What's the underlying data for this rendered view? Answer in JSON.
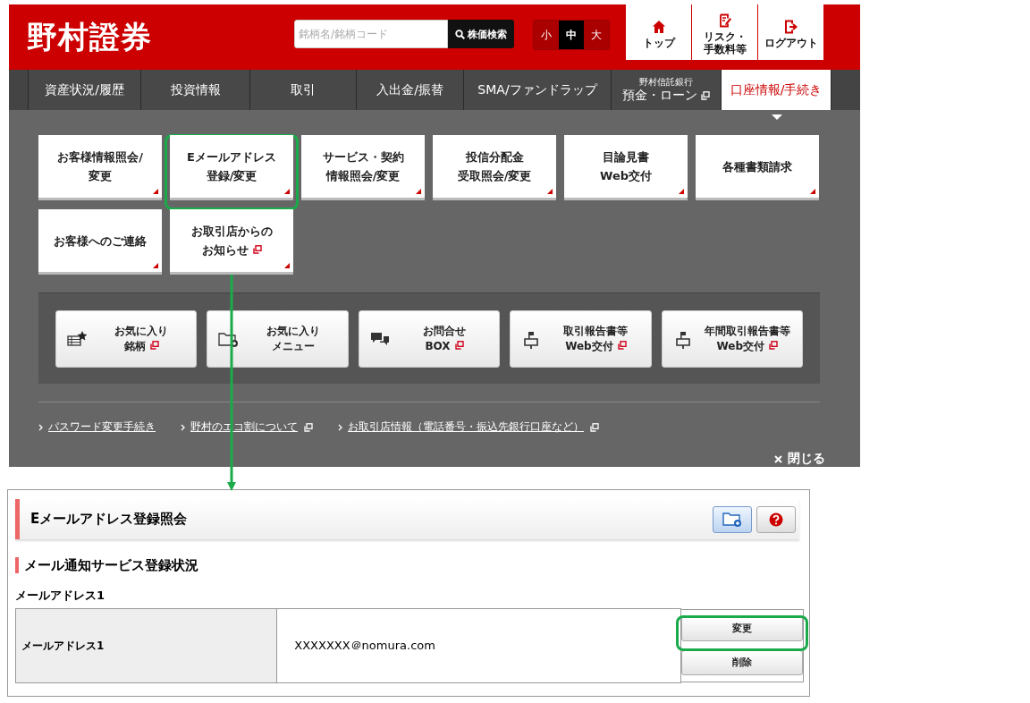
{
  "header": {
    "logo": "野村證券",
    "search": {
      "placeholder": "銘柄名/銘柄コード",
      "button": "株価検索"
    },
    "font_sizes": [
      {
        "label": "小",
        "selected": false
      },
      {
        "label": "中",
        "selected": true
      },
      {
        "label": "大",
        "selected": false
      }
    ],
    "top_links": [
      {
        "kind": "home",
        "label": "トップ"
      },
      {
        "kind": "risk",
        "label": [
          "リスク・",
          "手数料等"
        ]
      },
      {
        "kind": "logout",
        "label": "ログアウト"
      }
    ]
  },
  "nav": {
    "items": [
      {
        "label": "資産状況/履歴",
        "selected": false,
        "external": false
      },
      {
        "label": "投資情報",
        "selected": false,
        "external": false
      },
      {
        "label": "取引",
        "selected": false,
        "external": false
      },
      {
        "label": "入出金/振替",
        "selected": false,
        "external": false
      },
      {
        "label": "SMA/ファンドラップ",
        "selected": false,
        "external": false
      },
      {
        "sublabel": "野村信託銀行",
        "label": "預金・ローン",
        "selected": false,
        "external": true
      },
      {
        "label": "口座情報/手続き",
        "selected": true,
        "external": false
      }
    ]
  },
  "menu": {
    "tiles": [
      {
        "label": [
          "お客様情報照会/",
          "変更"
        ],
        "external": false,
        "highlighted": false
      },
      {
        "label": [
          "Eメールアドレス",
          "登録/変更"
        ],
        "external": false,
        "highlighted": true
      },
      {
        "label": [
          "サービス・契約",
          "情報照会/変更"
        ],
        "external": false,
        "highlighted": false
      },
      {
        "label": [
          "投信分配金",
          "受取照会/変更"
        ],
        "external": false,
        "highlighted": false
      },
      {
        "label": [
          "目論見書",
          "Web交付"
        ],
        "external": false,
        "highlighted": false
      },
      {
        "label": [
          "各種書類請求"
        ],
        "external": false,
        "highlighted": false
      },
      {
        "label": [
          "お客様へのご連絡"
        ],
        "external": false,
        "highlighted": false
      },
      {
        "label": [
          "お取引店からの",
          "お知らせ"
        ],
        "external": true,
        "highlighted": false
      }
    ],
    "shortcuts": [
      {
        "kind": "favorite-stocks",
        "label": [
          "お気に入り",
          "銘柄"
        ],
        "external": true
      },
      {
        "kind": "favorite-menu",
        "label": [
          "お気に入り",
          "メニュー"
        ],
        "external": false
      },
      {
        "kind": "inquiry",
        "label": [
          "お問合せ",
          "BOX"
        ],
        "external": true
      },
      {
        "kind": "mailbox",
        "label": [
          "取引報告書等",
          "Web交付"
        ],
        "external": true
      },
      {
        "kind": "mailbox",
        "label": [
          "年間取引報告書等",
          "Web交付"
        ],
        "external": true
      }
    ],
    "links": [
      {
        "label": "パスワード変更手続き",
        "external": false
      },
      {
        "label": "野村のエコ割について",
        "external": true
      },
      {
        "label": "お取引店情報（電話番号・振込先銀行口座など）",
        "external": true
      }
    ],
    "close": "閉じる"
  },
  "panel": {
    "title": "Eメールアドレス登録照会",
    "section_title": "メール通知サービス登録状況",
    "group_label": "メールアドレス1",
    "rows": [
      {
        "label": "メールアドレス1",
        "value": "XXXXXXX＠nomura.com",
        "actions": [
          {
            "label": "変更",
            "highlighted": true
          },
          {
            "label": "削除",
            "highlighted": false
          }
        ]
      }
    ]
  }
}
